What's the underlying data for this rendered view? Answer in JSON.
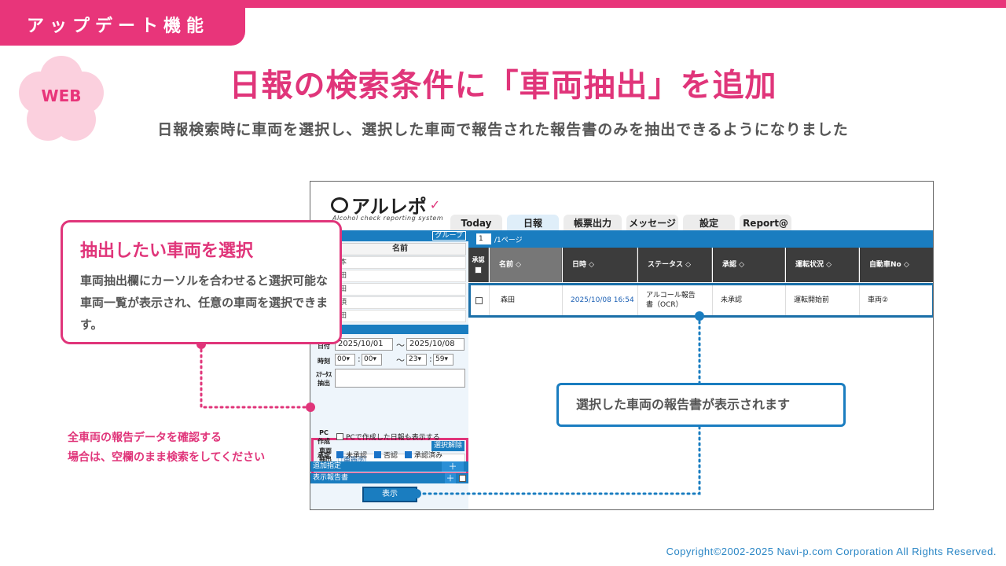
{
  "header": {
    "tag": "アップデート機能",
    "badge": "WEB",
    "title": "日報の検索条件に「車両抽出」を追加",
    "subtitle": "日報検索時に車両を選択し、選択した車両で報告された報告書のみを抽出できるようになりました"
  },
  "colors": {
    "pink": "#e0357a",
    "blue": "#1a7dc0",
    "flower": "#fbd0de"
  },
  "app": {
    "logo": "アルレポ",
    "logo_sub": "Alcohol check reporting system",
    "tabs": [
      "Today",
      "日報",
      "帳票出力",
      "メッセージ",
      "設定",
      "Report@"
    ],
    "active_tab": "日報",
    "left": {
      "group_button": "グループ",
      "name_header": "名前",
      "name_rows": [
        "本",
        "田",
        "田",
        "須",
        "田"
      ],
      "date_label": "日付",
      "date_from": "2025/10/01",
      "date_to": "2025/10/08",
      "tilde": "～",
      "time_label": "時刻",
      "time_from_h": "00",
      "time_from_m": "00",
      "time_to_h": "23",
      "time_to_m": "59",
      "colon": ":",
      "status_label": "ｽﾃｰﾀｽ抽出",
      "vehicle_label_1": "車両",
      "vehicle_label_2": "抽出",
      "clear_button": "選択解除",
      "vehicle_chip": "車両②",
      "pc_label_1": "PC",
      "pc_label_2": "作成",
      "pc_option": "PCで作成した日報も表示する",
      "approval_label": "承認",
      "approval_options": [
        "未承認",
        "否認",
        "承認済み"
      ],
      "add_bar": "追加指定",
      "report_bar": "表示報告書",
      "plus": "＋",
      "show_button": "表示"
    },
    "right": {
      "page_value": "1",
      "page_label": "/1ページ",
      "columns": [
        "承認",
        "名前",
        "日時",
        "ステータス",
        "承認",
        "運転状況",
        "自動車No"
      ],
      "sort_icon": "◇",
      "row": {
        "name": "森田",
        "datetime": "2025/10/08 16:54",
        "status_1": "アルコール報告",
        "status_2": "書（OCR）",
        "approval": "未承認",
        "driving": "運転開始前",
        "car_no": "車両②"
      }
    }
  },
  "callouts": {
    "left_title": "抽出したい車両を選択",
    "left_body": "車両抽出欄にカーソルを合わせると選択可能な車両一覧が表示され、任意の車両を選択できます。",
    "right_text": "選択した車両の報告書が表示されます",
    "note_1": "全車両の報告データを確認する",
    "note_2": "場合は、空欄のまま検索をしてください"
  },
  "copyright": "Copyright©2002-2025 Navi-p.com Corporation All Rights Reserved."
}
